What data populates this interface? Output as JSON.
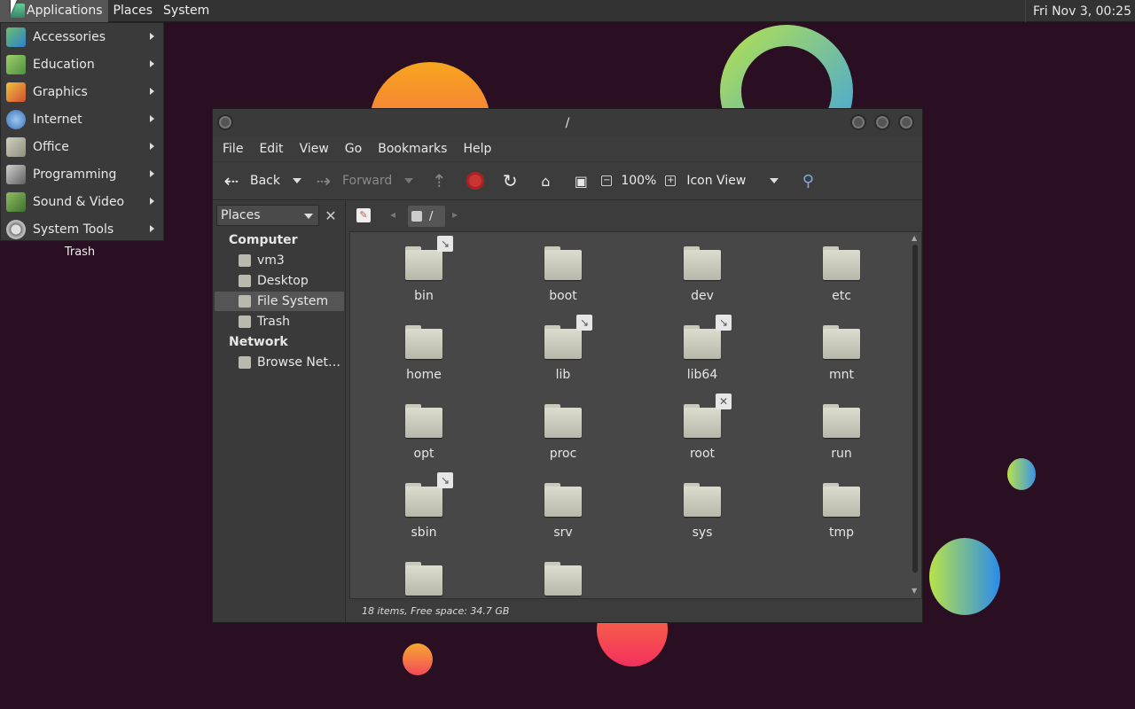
{
  "panel": {
    "menus": [
      "Applications",
      "Places",
      "System"
    ],
    "clock": "Fri Nov  3, 00:25"
  },
  "app_menu": {
    "items": [
      {
        "label": "Accessories",
        "icon": "accessories-icon"
      },
      {
        "label": "Education",
        "icon": "education-icon"
      },
      {
        "label": "Graphics",
        "icon": "graphics-icon"
      },
      {
        "label": "Internet",
        "icon": "internet-icon"
      },
      {
        "label": "Office",
        "icon": "office-icon"
      },
      {
        "label": "Programming",
        "icon": "programming-icon"
      },
      {
        "label": "Sound & Video",
        "icon": "sound-video-icon"
      },
      {
        "label": "System Tools",
        "icon": "system-tools-icon"
      }
    ]
  },
  "desktop": {
    "trash_label": "Trash"
  },
  "window": {
    "title": "/",
    "menubar": [
      "File",
      "Edit",
      "View",
      "Go",
      "Bookmarks",
      "Help"
    ],
    "toolbar": {
      "back": "Back",
      "forward": "Forward",
      "zoom": "100%",
      "view_mode": "Icon View"
    },
    "sidebar": {
      "selector": "Places",
      "sections": {
        "computer": "Computer",
        "network": "Network"
      },
      "items": [
        "vm3",
        "Desktop",
        "File System",
        "Trash",
        "Browse Net…"
      ]
    },
    "path": {
      "segment": "/"
    },
    "files": [
      {
        "name": "bin",
        "emblem": "symlink"
      },
      {
        "name": "boot",
        "emblem": ""
      },
      {
        "name": "dev",
        "emblem": ""
      },
      {
        "name": "etc",
        "emblem": ""
      },
      {
        "name": "home",
        "emblem": ""
      },
      {
        "name": "lib",
        "emblem": "symlink"
      },
      {
        "name": "lib64",
        "emblem": "symlink"
      },
      {
        "name": "mnt",
        "emblem": ""
      },
      {
        "name": "opt",
        "emblem": ""
      },
      {
        "name": "proc",
        "emblem": ""
      },
      {
        "name": "root",
        "emblem": "noaccess"
      },
      {
        "name": "run",
        "emblem": ""
      },
      {
        "name": "sbin",
        "emblem": "symlink"
      },
      {
        "name": "srv",
        "emblem": ""
      },
      {
        "name": "sys",
        "emblem": ""
      },
      {
        "name": "tmp",
        "emblem": ""
      },
      {
        "name": "",
        "emblem": ""
      },
      {
        "name": "",
        "emblem": ""
      }
    ],
    "status": "18 items, Free space: 34.7 GB"
  }
}
